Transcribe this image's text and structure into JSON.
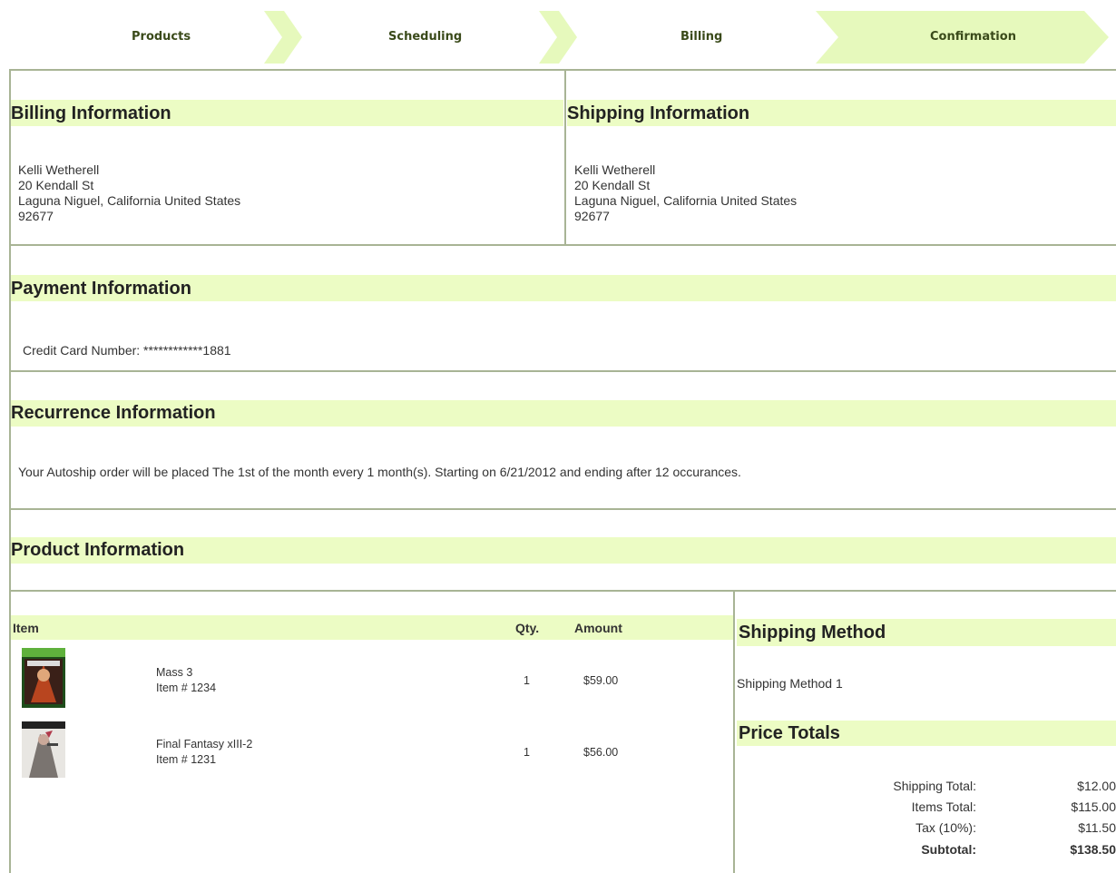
{
  "steps": [
    {
      "label": "Products"
    },
    {
      "label": "Scheduling"
    },
    {
      "label": "Billing"
    },
    {
      "label": "Confirmation"
    }
  ],
  "billing": {
    "title": "Billing Information",
    "name": "Kelli Wetherell",
    "street": "20 Kendall St",
    "city_line": "Laguna Niguel,  California  United States",
    "zip": "92677"
  },
  "shipping": {
    "title": "Shipping Information",
    "name": "Kelli Wetherell",
    "street": "20 Kendall St",
    "city_line": "Laguna Niguel,  California  United States",
    "zip": "92677"
  },
  "payment": {
    "title": "Payment Information",
    "card_line": "Credit Card Number: ************1881"
  },
  "recurrence": {
    "title": "Recurrence Information",
    "text": "Your Autoship order will be placed The 1st of the month every 1 month(s). Starting on 6/21/2012 and ending after 12 occurances."
  },
  "products": {
    "title": "Product Information",
    "col_item": "Item",
    "col_qty": "Qty.",
    "col_amount": "Amount",
    "items": [
      {
        "name": "Mass 3",
        "item_no": "Item # 1234",
        "qty": "1",
        "amount": "$59.00"
      },
      {
        "name": "Final Fantasy xIII-2",
        "item_no": "Item # 1231",
        "qty": "1",
        "amount": "$56.00"
      }
    ]
  },
  "shipping_method": {
    "title": "Shipping Method",
    "value": "Shipping Method 1"
  },
  "price_totals": {
    "title": "Price Totals",
    "rows": [
      {
        "label": "Shipping Total:",
        "value": "$12.00"
      },
      {
        "label": "Items Total:",
        "value": "$115.00"
      },
      {
        "label": "Tax (10%):",
        "value": "$11.50"
      },
      {
        "label": "Subtotal:",
        "value": "$138.50"
      }
    ]
  },
  "colors": {
    "band": "#ecfcc4",
    "border": "#a8b495",
    "step_arrow": "#e6f9bc"
  }
}
